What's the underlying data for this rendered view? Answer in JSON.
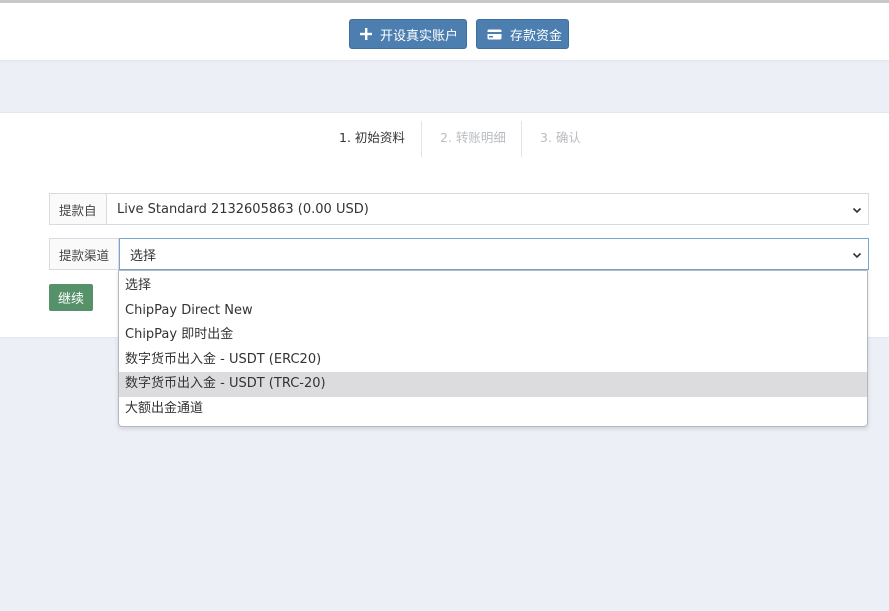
{
  "header": {
    "open_account_label": "开设真实账户",
    "deposit_label": "存款资金"
  },
  "steps": [
    {
      "label": "1. 初始资料",
      "state": "active"
    },
    {
      "label": "2. 转账明细",
      "state": "inactive"
    },
    {
      "label": "3. 确认",
      "state": "inactive"
    }
  ],
  "form": {
    "from": {
      "label": "提款自",
      "value": "Live Standard 2132605863 (0.00 USD)"
    },
    "channel": {
      "label": "提款渠道",
      "value": "选择",
      "options": [
        "选择",
        "ChipPay Direct New",
        "ChipPay 即时出金",
        "数字货币出入金 - USDT (ERC20)",
        "数字货币出入金 - USDT (TRC-20)",
        "大额出金通道"
      ],
      "highlighted_index": 4
    },
    "continue_label": "继续"
  },
  "colors": {
    "primary_button": "#4c7fb0",
    "continue_button": "#57916a",
    "background": "#eceff6"
  }
}
